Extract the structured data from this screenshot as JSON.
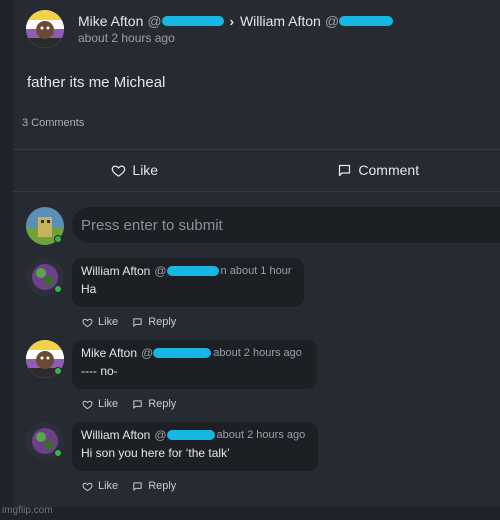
{
  "post": {
    "author": "Mike Afton",
    "handle_prefix": "@",
    "target": "William Afton",
    "target_handle_prefix": "@",
    "time": "about 2 hours ago",
    "text": "father its me Micheal",
    "comment_count": "3 Comments"
  },
  "actions": {
    "like": "Like",
    "comment": "Comment"
  },
  "composer": {
    "placeholder": "Press enter to submit"
  },
  "comments": [
    {
      "author": "William Afton",
      "handle_prefix": "@",
      "time": "n about 1 hour",
      "text": "Ha",
      "like": "Like",
      "reply": "Reply"
    },
    {
      "author": "Mike Afton",
      "handle_prefix": "@",
      "time": "about 2 hours ago",
      "text": "---- no-",
      "like": "Like",
      "reply": "Reply"
    },
    {
      "author": "William Afton",
      "handle_prefix": "@",
      "time": "about 2 hours ago",
      "text": "Hi son you here for ‘the talk’",
      "like": "Like",
      "reply": "Reply"
    }
  ],
  "watermark": "imgflip.com",
  "colors": {
    "background": "#1f2228",
    "card": "#262a31",
    "bubble": "#1c1f24",
    "redaction": "#17b7e4",
    "online": "#3bb34a"
  },
  "icons": [
    "heart-icon",
    "comment-icon",
    "reply-icon"
  ]
}
